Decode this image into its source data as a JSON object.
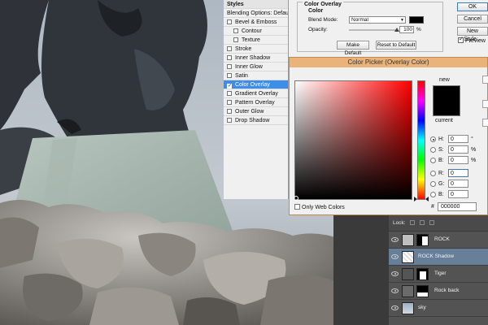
{
  "layer_style": {
    "styles_header": "Styles",
    "blending_options": "Blending Options: Default",
    "effects": [
      {
        "label": "Bevel & Emboss",
        "checked": false,
        "sub": false
      },
      {
        "label": "Contour",
        "checked": false,
        "sub": true
      },
      {
        "label": "Texture",
        "checked": false,
        "sub": true
      },
      {
        "label": "Stroke",
        "checked": false,
        "sub": false
      },
      {
        "label": "Inner Shadow",
        "checked": false,
        "sub": false
      },
      {
        "label": "Inner Glow",
        "checked": false,
        "sub": false
      },
      {
        "label": "Satin",
        "checked": false,
        "sub": false
      },
      {
        "label": "Color Overlay",
        "checked": true,
        "sub": false,
        "selected": true
      },
      {
        "label": "Gradient Overlay",
        "checked": false,
        "sub": false
      },
      {
        "label": "Pattern Overlay",
        "checked": false,
        "sub": false
      },
      {
        "label": "Outer Glow",
        "checked": false,
        "sub": false
      },
      {
        "label": "Drop Shadow",
        "checked": false,
        "sub": false
      }
    ],
    "group_title": "Color Overlay",
    "group_sub": "Color",
    "blend_mode_label": "Blend Mode:",
    "blend_mode_value": "Normal",
    "overlay_color": "#000000",
    "opacity_label": "Opacity:",
    "opacity_value": "100",
    "opacity_unit": "%",
    "make_default": "Make Default",
    "reset_default": "Reset to Default",
    "ok": "OK",
    "cancel": "Cancel",
    "new_style": "New Style...",
    "preview": "Preview",
    "preview_checked": true
  },
  "color_picker": {
    "title": "Color Picker (Overlay Color)",
    "new_label": "new",
    "current_label": "current",
    "new_color": "#000000",
    "hue_gradient_base": "#ff0000",
    "fields": [
      {
        "key": "H:",
        "value": "0",
        "unit": "°",
        "selected": true
      },
      {
        "key": "S:",
        "value": "0",
        "unit": "%",
        "selected": false
      },
      {
        "key": "B:",
        "value": "0",
        "unit": "%",
        "selected": false
      },
      {
        "key": "R:",
        "value": "0",
        "unit": "",
        "selected": false,
        "focus": true
      },
      {
        "key": "G:",
        "value": "0",
        "unit": "",
        "selected": false
      },
      {
        "key": "B:",
        "value": "0",
        "unit": "",
        "selected": false
      }
    ],
    "hex_label": "#",
    "hex_value": "000000",
    "only_web_colors": "Only Web Colors",
    "only_web_checked": false
  },
  "layers": {
    "lock_label": "Lock:",
    "items": [
      {
        "name": "ROCK",
        "selected": false,
        "has_mask": true
      },
      {
        "name": "ROCK Shadow",
        "selected": true,
        "has_mask": false
      },
      {
        "name": "Tiger",
        "selected": false,
        "has_mask": true
      },
      {
        "name": "Rock back",
        "selected": false,
        "has_mask": true
      },
      {
        "name": "sky",
        "selected": false,
        "has_mask": false
      }
    ]
  }
}
